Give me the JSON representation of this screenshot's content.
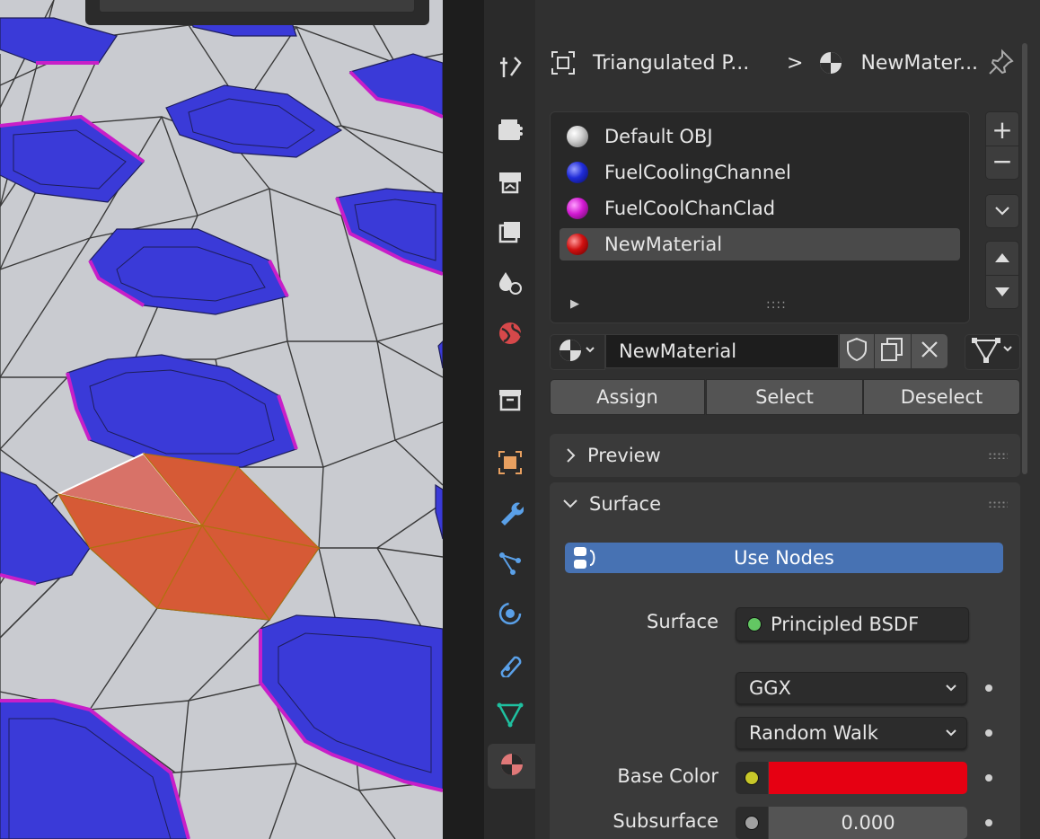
{
  "viewport": {
    "description_free": true,
    "colors": {
      "background": "#c8cacf",
      "hex_fill": "#3535d8",
      "hex_lines": "#222266",
      "rim": "#c020c0",
      "selected": "#d65a36",
      "active_face": "#d87268"
    }
  },
  "toolbar": {
    "editor_type_icon": "properties-editor-icon",
    "search_icon": "search-icon",
    "options_icon": "chevron-down-icon"
  },
  "tabs": [
    {
      "name": "tab-tool",
      "icon": "tool-icon"
    },
    {
      "name": "tab-render",
      "icon": "render-icon"
    },
    {
      "name": "tab-output",
      "icon": "output-icon"
    },
    {
      "name": "tab-view-layer",
      "icon": "view-layer-icon"
    },
    {
      "name": "tab-scene",
      "icon": "scene-icon"
    },
    {
      "name": "tab-world",
      "icon": "world-icon"
    },
    {
      "name": "tab-collection",
      "icon": "collection-icon"
    },
    {
      "name": "tab-object",
      "icon": "object-icon"
    },
    {
      "name": "tab-modifiers",
      "icon": "wrench-icon"
    },
    {
      "name": "tab-particles",
      "icon": "particles-icon"
    },
    {
      "name": "tab-physics",
      "icon": "physics-icon"
    },
    {
      "name": "tab-constraints",
      "icon": "constraints-icon"
    },
    {
      "name": "tab-data",
      "icon": "mesh-data-icon"
    },
    {
      "name": "tab-material",
      "icon": "material-icon"
    }
  ],
  "breadcrumb": {
    "object": "Triangulated P...",
    "separator": ">",
    "material": "NewMater..."
  },
  "material_slots": {
    "items": [
      {
        "label": "Default OBJ",
        "color": "#d9d9d9"
      },
      {
        "label": "FuelCoolingChannel",
        "color": "#1f2bd8"
      },
      {
        "label": "FuelCoolChanClad",
        "color": "#d21ad2"
      },
      {
        "label": "NewMaterial",
        "color": "#d01010",
        "selected": true
      }
    ],
    "expand_arrow": "▶",
    "resize_grip": "::::",
    "add": "+",
    "remove": "−"
  },
  "material_field": {
    "value": "NewMaterial"
  },
  "assign_buttons": {
    "assign": "Assign",
    "select": "Select",
    "deselect": "Deselect"
  },
  "panels": {
    "preview": "Preview",
    "surface": "Surface"
  },
  "surface": {
    "use_nodes": "Use Nodes",
    "surface_label": "Surface",
    "surface_value": "Principled BSDF",
    "distribution": "GGX",
    "subsurface_method": "Random Walk",
    "base_color_label": "Base Color",
    "base_color": "#e60012",
    "subsurface_label": "Subsurface",
    "subsurface_value": "0.000"
  }
}
